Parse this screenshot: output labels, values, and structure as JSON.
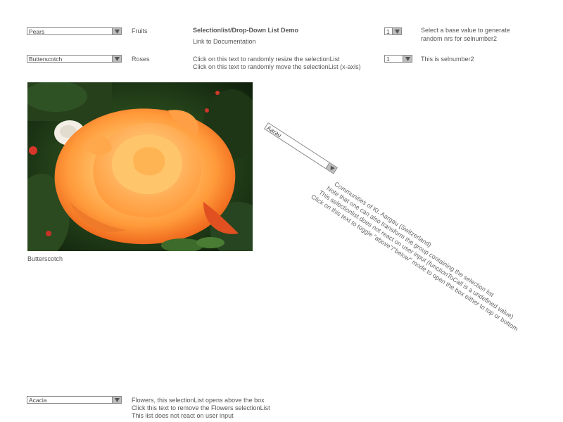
{
  "row1": {
    "select_value": "Pears",
    "label": "Fruits",
    "demo_title": "Selectionlist/Drop-Down List Demo",
    "doc_link": "Link to Documentation",
    "number_value": "1",
    "number_help": [
      "Select a base value to generate",
      "random nrs for selnumber2"
    ]
  },
  "row2": {
    "select_value": "Butterscotch",
    "label": "Roses",
    "resize_link": "Click on this text to randomly resize the selectionList",
    "move_link": "Click on this text to randomly move the selectionList (x-axis)",
    "number_value": "1",
    "number_help": "This is selnumber2"
  },
  "photo": {
    "caption": "Butterscotch"
  },
  "rotated": {
    "select_value": "Aarau",
    "lines": [
      "Communities of Kt. Aargau (Switzerland)",
      "Note that one can also transform the group containing the selection list",
      "This selectionlist does not react on user input (functionToCall is a undefined value)",
      "Click on this text to toggle \"above\"/\"below\" mode to open the box either to top or bottom"
    ]
  },
  "bottom": {
    "select_value": "Acacia",
    "lines": [
      "Flowers, this selectionList opens above the box",
      "Click this text to remove the Flowers selectionList",
      "This list does not react on user input"
    ]
  },
  "colors": {
    "arrow_bg": "#bdbdbd",
    "border": "#8a8a8a",
    "text": "#555555"
  }
}
